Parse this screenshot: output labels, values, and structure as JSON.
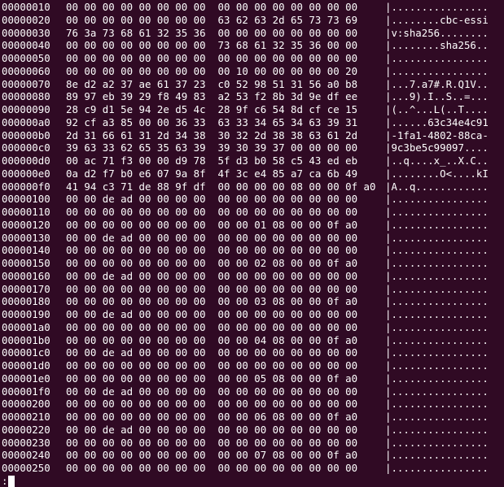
{
  "terminal": {
    "background": "#300a24",
    "foreground": "#ffffff",
    "rows": [
      {
        "offset": "00000010",
        "hex": "00 00 00 00 00 00 00 00  00 00 00 00 00 00 00 00",
        "ascii": "|................"
      },
      {
        "offset": "00000020",
        "hex": "00 00 00 00 00 00 00 00  63 62 63 2d 65 73 73 69",
        "ascii": "|........cbc-essi"
      },
      {
        "offset": "00000030",
        "hex": "76 3a 73 68 61 32 35 36  00 00 00 00 00 00 00 00",
        "ascii": "|v:sha256........"
      },
      {
        "offset": "00000040",
        "hex": "00 00 00 00 00 00 00 00  73 68 61 32 35 36 00 00",
        "ascii": "|........sha256.."
      },
      {
        "offset": "00000050",
        "hex": "00 00 00 00 00 00 00 00  00 00 00 00 00 00 00 00",
        "ascii": "|................"
      },
      {
        "offset": "00000060",
        "hex": "00 00 00 00 00 00 00 00  00 10 00 00 00 00 00 20",
        "ascii": "|................"
      },
      {
        "offset": "00000070",
        "hex": "8e d2 a2 37 ae 61 37 23  c0 52 98 51 31 56 a0 b8",
        "ascii": "|...7.a7#.R.Q1V.."
      },
      {
        "offset": "00000080",
        "hex": "89 97 eb 39 29 f8 49 83  a2 53 f2 8b 3d 9e df ee",
        "ascii": "|...9).I..S..=..."
      },
      {
        "offset": "00000090",
        "hex": "28 c9 d1 5e 94 2e d5 4c  28 9f c6 54 8d cf ce 15",
        "ascii": "|(..^...L(..T...."
      },
      {
        "offset": "000000a0",
        "hex": "92 cf a3 85 00 00 36 33  63 33 34 65 34 63 39 31",
        "ascii": "|......63c34e4c91"
      },
      {
        "offset": "000000b0",
        "hex": "2d 31 66 61 31 2d 34 38  30 32 2d 38 38 63 61 2d",
        "ascii": "|-1fa1-4802-88ca-"
      },
      {
        "offset": "000000c0",
        "hex": "39 63 33 62 65 35 63 39  39 30 39 37 00 00 00 00",
        "ascii": "|9c3be5c99097...."
      },
      {
        "offset": "000000d0",
        "hex": "00 ac 71 f3 00 00 d9 78  5f d3 b0 58 c5 43 ed eb",
        "ascii": "|..q....x_..X.C.."
      },
      {
        "offset": "000000e0",
        "hex": "0a d2 f7 b0 e6 07 9a 8f  4f 3c e4 85 a7 ca 6b 49",
        "ascii": "|........O<....kI"
      },
      {
        "offset": "000000f0",
        "hex": "41 94 c3 71 de 88 9f df  00 00 00 00 08 00 00 0f a0",
        "ascii": "|A..q............"
      },
      {
        "offset": "00000100",
        "hex": "00 00 de ad 00 00 00 00  00 00 00 00 00 00 00 00",
        "ascii": "|................"
      },
      {
        "offset": "00000110",
        "hex": "00 00 00 00 00 00 00 00  00 00 00 00 00 00 00 00",
        "ascii": "|................"
      },
      {
        "offset": "00000120",
        "hex": "00 00 00 00 00 00 00 00  00 00 01 08 00 00 0f a0",
        "ascii": "|................"
      },
      {
        "offset": "00000130",
        "hex": "00 00 de ad 00 00 00 00  00 00 00 00 00 00 00 00",
        "ascii": "|................"
      },
      {
        "offset": "00000140",
        "hex": "00 00 00 00 00 00 00 00  00 00 00 00 00 00 00 00",
        "ascii": "|................"
      },
      {
        "offset": "00000150",
        "hex": "00 00 00 00 00 00 00 00  00 00 02 08 00 00 0f a0",
        "ascii": "|................"
      },
      {
        "offset": "00000160",
        "hex": "00 00 de ad 00 00 00 00  00 00 00 00 00 00 00 00",
        "ascii": "|................"
      },
      {
        "offset": "00000170",
        "hex": "00 00 00 00 00 00 00 00  00 00 00 00 00 00 00 00",
        "ascii": "|................"
      },
      {
        "offset": "00000180",
        "hex": "00 00 00 00 00 00 00 00  00 00 03 08 00 00 0f a0",
        "ascii": "|................"
      },
      {
        "offset": "00000190",
        "hex": "00 00 de ad 00 00 00 00  00 00 00 00 00 00 00 00",
        "ascii": "|................"
      },
      {
        "offset": "000001a0",
        "hex": "00 00 00 00 00 00 00 00  00 00 00 00 00 00 00 00",
        "ascii": "|................"
      },
      {
        "offset": "000001b0",
        "hex": "00 00 00 00 00 00 00 00  00 00 04 08 00 00 0f a0",
        "ascii": "|................"
      },
      {
        "offset": "000001c0",
        "hex": "00 00 de ad 00 00 00 00  00 00 00 00 00 00 00 00",
        "ascii": "|................"
      },
      {
        "offset": "000001d0",
        "hex": "00 00 00 00 00 00 00 00  00 00 00 00 00 00 00 00",
        "ascii": "|................"
      },
      {
        "offset": "000001e0",
        "hex": "00 00 00 00 00 00 00 00  00 00 05 08 00 00 0f a0",
        "ascii": "|................"
      },
      {
        "offset": "000001f0",
        "hex": "00 00 de ad 00 00 00 00  00 00 00 00 00 00 00 00",
        "ascii": "|................"
      },
      {
        "offset": "00000200",
        "hex": "00 00 00 00 00 00 00 00  00 00 00 00 00 00 00 00",
        "ascii": "|................"
      },
      {
        "offset": "00000210",
        "hex": "00 00 00 00 00 00 00 00  00 00 06 08 00 00 0f a0",
        "ascii": "|................"
      },
      {
        "offset": "00000220",
        "hex": "00 00 de ad 00 00 00 00  00 00 00 00 00 00 00 00",
        "ascii": "|................"
      },
      {
        "offset": "00000230",
        "hex": "00 00 00 00 00 00 00 00  00 00 00 00 00 00 00 00",
        "ascii": "|................"
      },
      {
        "offset": "00000240",
        "hex": "00 00 00 00 00 00 00 00  00 00 07 08 00 00 0f a0",
        "ascii": "|................"
      },
      {
        "offset": "00000250",
        "hex": "00 00 00 00 00 00 00 00  00 00 00 00 00 00 00 00",
        "ascii": "|................"
      }
    ],
    "prompt": ":"
  }
}
